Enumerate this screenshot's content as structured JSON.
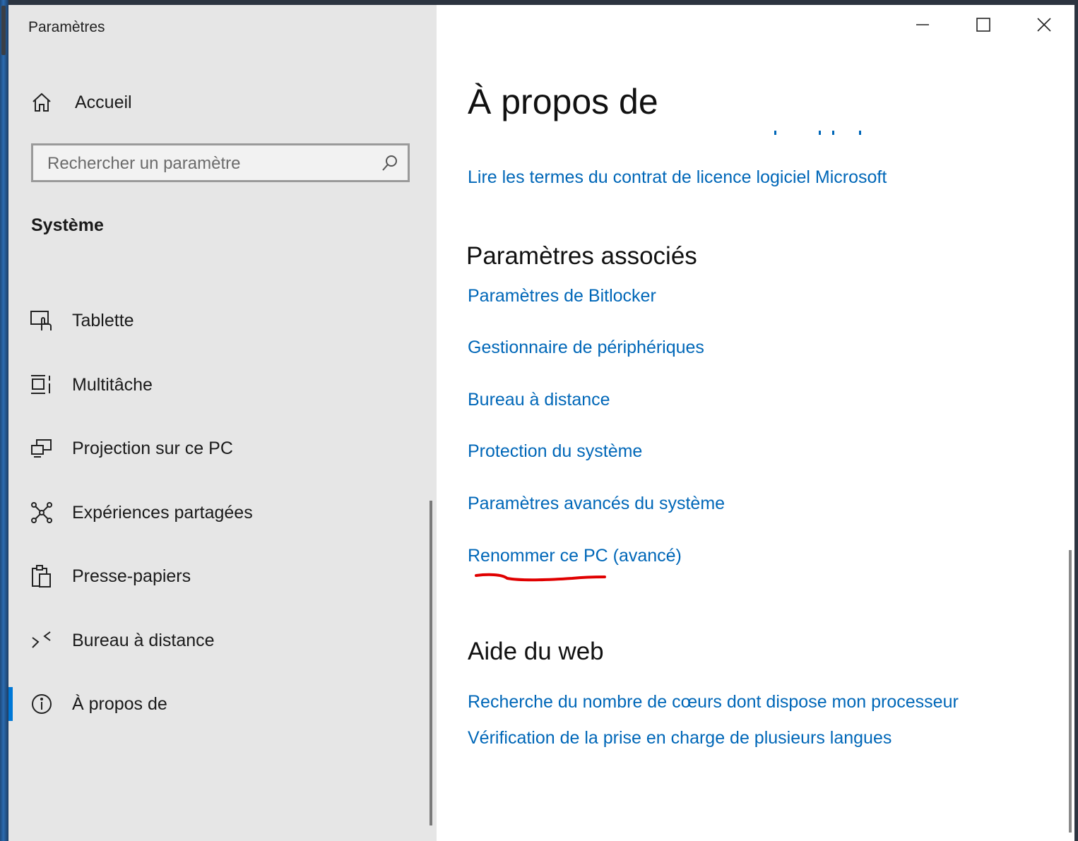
{
  "window": {
    "title": "Paramètres",
    "controls": {
      "minimize": "minimize",
      "maximize": "maximize",
      "close": "close"
    }
  },
  "sidebar": {
    "home_label": "Accueil",
    "search": {
      "placeholder": "Rechercher un paramètre",
      "value": ""
    },
    "section_title": "Système",
    "items": [
      {
        "label": "Tablette",
        "icon": "tablet-icon"
      },
      {
        "label": "Multitâche",
        "icon": "multitasking-icon"
      },
      {
        "label": "Projection sur ce PC",
        "icon": "projection-icon"
      },
      {
        "label": "Expériences partagées",
        "icon": "shared-experiences-icon"
      },
      {
        "label": "Presse-papiers",
        "icon": "clipboard-icon"
      },
      {
        "label": "Bureau à distance",
        "icon": "remote-desktop-icon"
      },
      {
        "label": "À propos de",
        "icon": "info-icon",
        "active": true
      }
    ]
  },
  "main": {
    "page_title": "À propos de",
    "license_link": "Lire les termes du contrat de licence logiciel Microsoft",
    "related_settings": {
      "heading": "Paramètres associés",
      "links": [
        "Paramètres de Bitlocker",
        "Gestionnaire de périphériques",
        "Bureau à distance",
        "Protection du système",
        "Paramètres avancés du système",
        "Renommer ce PC (avancé)"
      ]
    },
    "web_help": {
      "heading": "Aide du web",
      "links": [
        "Recherche du nombre de cœurs dont dispose mon processeur",
        "Vérification de la prise en charge de plusieurs langues"
      ]
    }
  },
  "colors": {
    "accent": "#0078d7",
    "link": "#0067b8",
    "sidebar_bg": "#e6e6e6",
    "annotation": "#e00000"
  }
}
